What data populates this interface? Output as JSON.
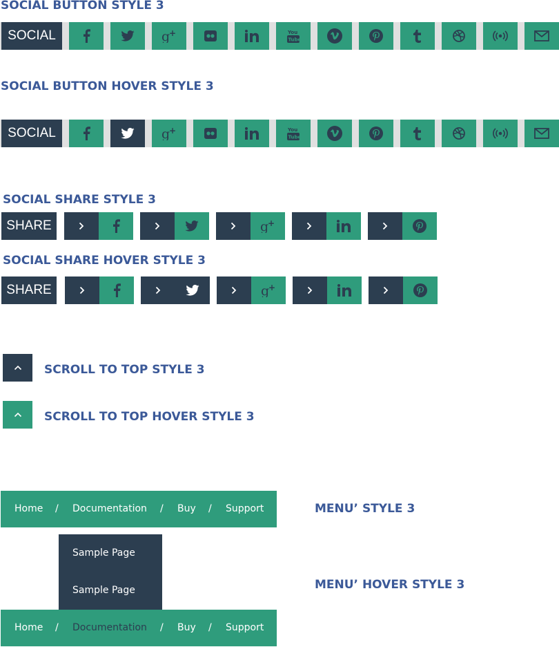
{
  "headings": {
    "social_button": "SOCIAL BUTTON STYLE 3",
    "social_button_hover": "SOCIAL BUTTON HOVER STYLE 3",
    "social_share": "SOCIAL SHARE STYLE 3",
    "social_share_hover": "SOCIAL SHARE HOVER STYLE 3",
    "scroll_top": "SCROLL TO TOP STYLE 3",
    "scroll_top_hover": "SCROLL TO TOP HOVER STYLE 3",
    "menu": "MENU’ STYLE 3",
    "menu_hover": "MENU’ HOVER STYLE 3"
  },
  "social_label": "SOCIAL",
  "social_icons": [
    "facebook-icon",
    "twitter-icon",
    "google-plus-icon",
    "flickr-icon",
    "linkedin-icon",
    "youtube-icon",
    "vimeo-icon",
    "pinterest-icon",
    "tumblr-icon",
    "dribbble-icon",
    "podcast-icon",
    "mail-icon"
  ],
  "social_hover_active": "twitter-icon",
  "share_label": "SHARE",
  "share_icons": [
    "facebook-icon",
    "twitter-icon",
    "google-plus-icon",
    "linkedin-icon",
    "pinterest-icon"
  ],
  "share_hover_active": "twitter-icon",
  "menu": {
    "items": [
      "Home",
      "Documentation",
      "Buy",
      "Support"
    ],
    "separator": "/",
    "submenu": [
      "Sample Page",
      "Sample Page"
    ],
    "hover_active": "Documentation"
  },
  "colors": {
    "green": "#2f9c7c",
    "dark": "#2c3e50",
    "heading": "#3b5998",
    "bar_bg": "#e0e0e0"
  }
}
